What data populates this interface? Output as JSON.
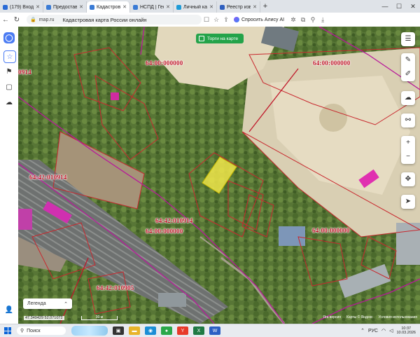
{
  "browser": {
    "tabs": [
      {
        "label": "(179) Входящие - ",
        "color": "#2a6bd6"
      },
      {
        "label": "Предоставление",
        "color": "#3a7bd5"
      },
      {
        "label": "Кадастровая к",
        "color": "#3a7bd5",
        "active": true
      },
      {
        "label": "НСПД | Геоинфо",
        "color": "#3a7bd5"
      },
      {
        "label": "Личный кабинет",
        "color": "#1e9bd7"
      },
      {
        "label": "Реестр извещени",
        "color": "#2f5fbf"
      }
    ],
    "new_tab": "+",
    "url": "map.ru",
    "page_title": "Кадастровая карта России онлайн",
    "alice_label": "Спросить Алису AI"
  },
  "map": {
    "torgi_label": "Торги на карте",
    "cadastral_labels": [
      "64:00:000000",
      "64:00:000000",
      "64:42:010914",
      "0914",
      "64:42:010914",
      "64:00:000000",
      "64:00:000000",
      "64:42:010905"
    ],
    "legend_label": "Легенда",
    "coords": "47.349429 52.071072",
    "scale": "30 м",
    "attribution": [
      "Яга версия",
      "Карты © Яндекс",
      "Условия использования"
    ]
  },
  "taskbar": {
    "search": "Поиск",
    "lang": "РУС",
    "time": "10:37",
    "date": "10.03.2026"
  }
}
